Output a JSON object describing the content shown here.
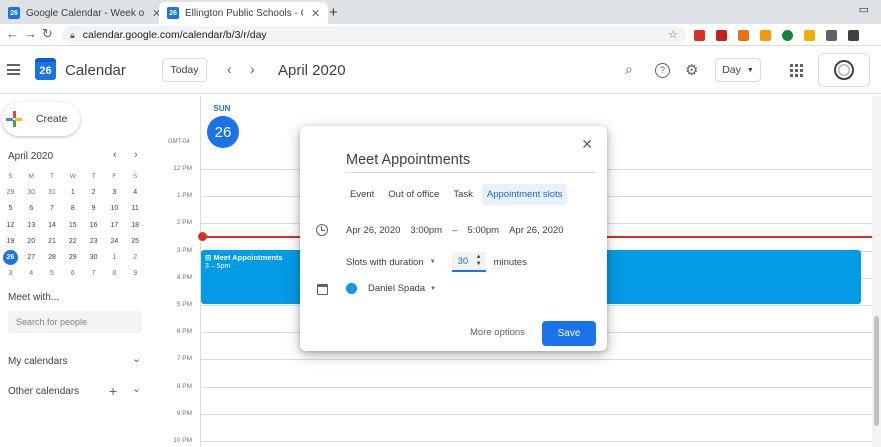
{
  "browser": {
    "tabs": [
      {
        "favicon": "26",
        "title": "Google Calendar - Week of April",
        "close": "✕"
      },
      {
        "favicon": "26",
        "title": "Ellington Public Schools - Calendar",
        "close": "✕"
      }
    ],
    "new_tab": "+",
    "url": "calendar.google.com/calendar/b/3/r/day",
    "extension_colors": [
      "#d93025",
      "#c5221f",
      "#e8710a",
      "#f29900",
      "#188038",
      "#f9ab00",
      "#5f6368",
      "#3c4043"
    ]
  },
  "header": {
    "logo_number": "26",
    "app_name": "Calendar",
    "today_label": "Today",
    "prev_icon": "‹",
    "next_icon": "›",
    "period": "April 2020",
    "search_icon": "⌕",
    "help_icon": "?",
    "settings_icon": "⚙",
    "view_label": "Day",
    "view_caret": "▼"
  },
  "sidebar": {
    "create_label": "Create",
    "mini_calendar": {
      "title": "April 2020",
      "weekday_headers": [
        "S",
        "M",
        "T",
        "W",
        "T",
        "F",
        "S"
      ],
      "weeks": [
        [
          "29",
          "30",
          "31",
          "1",
          "2",
          "3",
          "4"
        ],
        [
          "5",
          "6",
          "7",
          "8",
          "9",
          "10",
          "11"
        ],
        [
          "12",
          "13",
          "14",
          "15",
          "16",
          "17",
          "18"
        ],
        [
          "19",
          "20",
          "21",
          "22",
          "23",
          "24",
          "25"
        ],
        [
          "26",
          "27",
          "28",
          "29",
          "30",
          "1",
          "2"
        ],
        [
          "3",
          "4",
          "5",
          "6",
          "7",
          "8",
          "9"
        ]
      ],
      "selected": "26"
    },
    "meet_with_label": "Meet with...",
    "search_people_placeholder": "Search for people",
    "my_calendars_label": "My calendars",
    "other_calendars_label": "Other calendars",
    "add_icon": "+",
    "expand_icon": "⌄"
  },
  "day_view": {
    "weekday": "SUN",
    "day_number": "26",
    "timezone": "GMT-04",
    "hours": [
      "12 PM",
      "1 PM",
      "2 PM",
      "3 PM",
      "4 PM",
      "5 PM",
      "6 PM",
      "7 PM",
      "8 PM",
      "9 PM",
      "10 PM"
    ],
    "event": {
      "title": "Meet Appointments",
      "time": "3 – 5pm",
      "color": "#039be5"
    }
  },
  "dialog": {
    "title": "Meet Appointments",
    "close_icon": "✕",
    "type_tabs": [
      "Event",
      "Out of office",
      "Task",
      "Appointment slots"
    ],
    "active_tab": "Appointment slots",
    "start_date": "Apr 26, 2020",
    "start_time": "3:00pm",
    "separator": "–",
    "end_time": "5:00pm",
    "end_date": "Apr 26, 2020",
    "duration_mode": "Slots with duration",
    "duration_value": "30",
    "duration_unit": "minutes",
    "owner": "Daniel Spada",
    "owner_color": "#039be5",
    "more_options_label": "More options",
    "save_label": "Save",
    "accent_color": "#1a73e8"
  }
}
